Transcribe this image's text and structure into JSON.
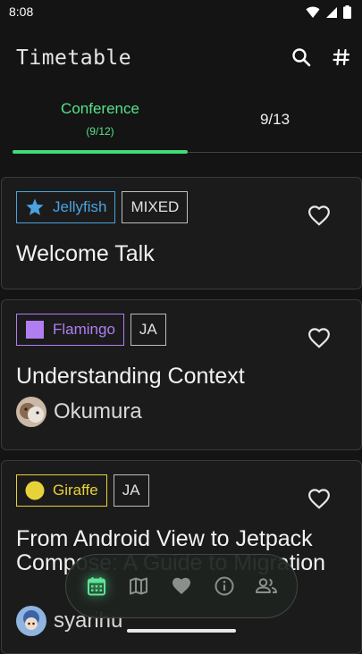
{
  "status": {
    "time": "8:08"
  },
  "app_bar": {
    "title": "Timetable",
    "search_icon": "search-icon",
    "hashtag_icon": "hashtag-icon"
  },
  "tabs": [
    {
      "label": "Conference",
      "sublabel": "(9/12)",
      "selected": true
    },
    {
      "label": "9/13",
      "selected": false
    }
  ],
  "sessions": [
    {
      "room": "Jellyfish",
      "room_icon": "star-icon",
      "room_color": "#4aa3e0",
      "language": "MIXED",
      "title": "Welcome Talk",
      "speaker": ""
    },
    {
      "room": "Flamingo",
      "room_icon": "square-icon",
      "room_color": "#b07ef0",
      "language": "JA",
      "title": "Understanding Context",
      "speaker": "Okumura"
    },
    {
      "room": "Giraffe",
      "room_icon": "circle-icon",
      "room_color": "#e8d23a",
      "language": "JA",
      "title": "From Android View to Jetpack Compose: A Guide to Migration",
      "speaker": "syarihu"
    }
  ],
  "bottom_nav": [
    {
      "icon": "calendar-icon",
      "active": true
    },
    {
      "icon": "map-icon",
      "active": false
    },
    {
      "icon": "heart-icon",
      "active": false
    },
    {
      "icon": "info-icon",
      "active": false
    },
    {
      "icon": "people-icon",
      "active": false
    }
  ],
  "colors": {
    "accent": "#56e38a",
    "background": "#141414"
  }
}
